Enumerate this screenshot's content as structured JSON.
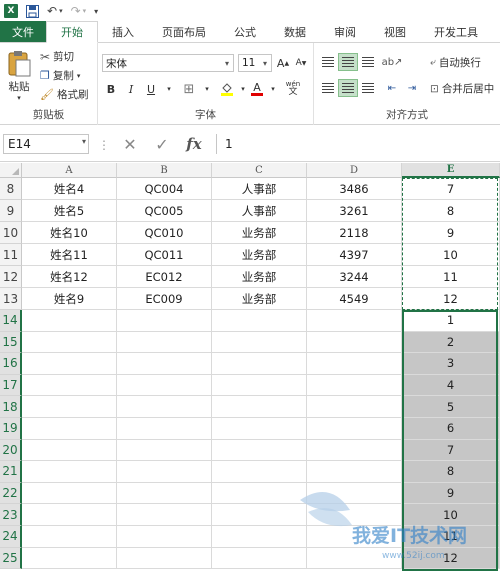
{
  "app": {
    "icon_letter": "X"
  },
  "quick_access": {
    "save_icon": "save-icon",
    "undo_icon": "undo-icon",
    "redo_icon": "redo-icon",
    "customize_icon": "customize-icon"
  },
  "tabs": [
    {
      "label": "文件"
    },
    {
      "label": "开始"
    },
    {
      "label": "插入"
    },
    {
      "label": "页面布局"
    },
    {
      "label": "公式"
    },
    {
      "label": "数据"
    },
    {
      "label": "审阅"
    },
    {
      "label": "视图"
    },
    {
      "label": "开发工具"
    }
  ],
  "ribbon": {
    "clipboard": {
      "paste": "粘贴",
      "cut": "剪切",
      "copy": "复制",
      "format_painter": "格式刷",
      "label": "剪贴板"
    },
    "font": {
      "font_name": "宋体",
      "font_size": "11",
      "bold": "B",
      "italic": "I",
      "underline": "U",
      "label": "字体"
    },
    "alignment": {
      "wrap_text": "自动换行",
      "merge_center": "合并后居中",
      "label": "对齐方式"
    }
  },
  "formula_bar": {
    "name_box": "E14",
    "formula": "1"
  },
  "columns": [
    "A",
    "B",
    "C",
    "D",
    "E"
  ],
  "rows": [
    {
      "num": "8",
      "a": "姓名4",
      "b": "QC004",
      "c": "人事部",
      "d": "3486",
      "e": "7"
    },
    {
      "num": "9",
      "a": "姓名5",
      "b": "QC005",
      "c": "人事部",
      "d": "3261",
      "e": "8"
    },
    {
      "num": "10",
      "a": "姓名10",
      "b": "QC010",
      "c": "业务部",
      "d": "2118",
      "e": "9"
    },
    {
      "num": "11",
      "a": "姓名11",
      "b": "QC011",
      "c": "业务部",
      "d": "4397",
      "e": "10"
    },
    {
      "num": "12",
      "a": "姓名12",
      "b": "EC012",
      "c": "业务部",
      "d": "3244",
      "e": "11"
    },
    {
      "num": "13",
      "a": "姓名9",
      "b": "EC009",
      "c": "业务部",
      "d": "4549",
      "e": "12"
    },
    {
      "num": "14",
      "a": "",
      "b": "",
      "c": "",
      "d": "",
      "e": "1"
    },
    {
      "num": "15",
      "a": "",
      "b": "",
      "c": "",
      "d": "",
      "e": "2"
    },
    {
      "num": "16",
      "a": "",
      "b": "",
      "c": "",
      "d": "",
      "e": "3"
    },
    {
      "num": "17",
      "a": "",
      "b": "",
      "c": "",
      "d": "",
      "e": "4"
    },
    {
      "num": "18",
      "a": "",
      "b": "",
      "c": "",
      "d": "",
      "e": "5"
    },
    {
      "num": "19",
      "a": "",
      "b": "",
      "c": "",
      "d": "",
      "e": "6"
    },
    {
      "num": "20",
      "a": "",
      "b": "",
      "c": "",
      "d": "",
      "e": "7"
    },
    {
      "num": "21",
      "a": "",
      "b": "",
      "c": "",
      "d": "",
      "e": "8"
    },
    {
      "num": "22",
      "a": "",
      "b": "",
      "c": "",
      "d": "",
      "e": "9"
    },
    {
      "num": "23",
      "a": "",
      "b": "",
      "c": "",
      "d": "",
      "e": "10"
    },
    {
      "num": "24",
      "a": "",
      "b": "",
      "c": "",
      "d": "",
      "e": "11"
    },
    {
      "num": "25",
      "a": "",
      "b": "",
      "c": "",
      "d": "",
      "e": "12"
    }
  ],
  "watermark": {
    "text": "我爱IT技术网",
    "url": "www.52ij.com"
  },
  "colors": {
    "accent": "#217346",
    "selection": "#c6c6c6"
  }
}
